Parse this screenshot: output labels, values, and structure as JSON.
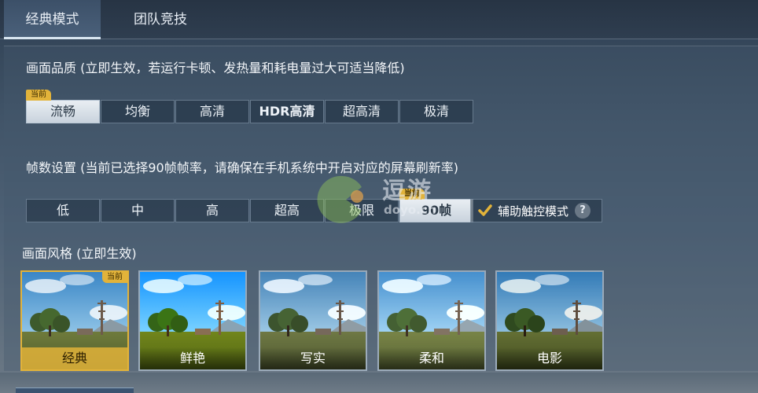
{
  "tabs": [
    {
      "label": "经典模式",
      "active": true
    },
    {
      "label": "团队竞技",
      "active": false
    }
  ],
  "quality": {
    "title": "画面品质 (立即生效，若运行卡顿、发热量和耗电量过大可适当降低)",
    "options": [
      "流畅",
      "均衡",
      "高清",
      "HDR高清",
      "超高清",
      "极清"
    ],
    "selected_index": 0,
    "current_badge": "当前"
  },
  "framerate": {
    "title": "帧数设置 (当前已选择90帧帧率，请确保在手机系统中开启对应的屏幕刷新率)",
    "options": [
      "低",
      "中",
      "高",
      "超高",
      "极限",
      "90帧"
    ],
    "selected_index": 5,
    "current_badge": "当前",
    "assist_label": "辅助触控模式",
    "help_symbol": "?"
  },
  "style": {
    "title": "画面风格 (立即生效)",
    "current_badge": "当前",
    "selected_index": 0,
    "cards": [
      "经典",
      "鲜艳",
      "写实",
      "柔和",
      "电影"
    ]
  },
  "watermark": {
    "text": "逗游",
    "url": "doyo.cn"
  },
  "colors": {
    "badge": "#e2b33a",
    "selected_bg": "#e9eef3",
    "panel_bg": "#415468"
  }
}
